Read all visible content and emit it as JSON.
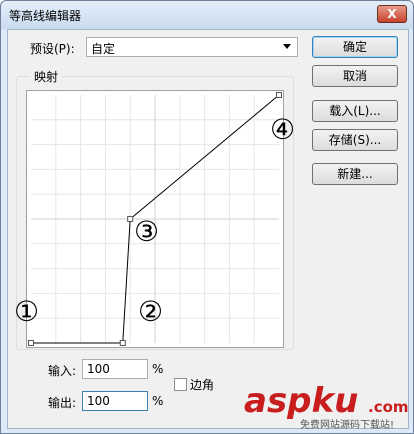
{
  "window": {
    "title": "等高线编辑器",
    "close": "X"
  },
  "preset": {
    "label": "预设(P):",
    "value": "自定"
  },
  "buttons": {
    "ok": "确定",
    "cancel": "取消",
    "load": "载入(L)...",
    "save": "存储(S)...",
    "new": "新建..."
  },
  "mapping": {
    "label": "映射"
  },
  "annotations": [
    "①",
    "②",
    "③",
    "④"
  ],
  "io": {
    "input_label": "输入:",
    "input_value": "100",
    "output_label": "输出:",
    "output_value": "100",
    "percent": "%"
  },
  "corner": {
    "label": "边角",
    "checked": false
  },
  "curve_points": [
    [
      0,
      0
    ],
    [
      37,
      0
    ],
    [
      40,
      50
    ],
    [
      100,
      100
    ]
  ],
  "watermark": {
    "brand": "aspku",
    "suffix": ".com",
    "slogan": "免费网站源码下载站!"
  }
}
